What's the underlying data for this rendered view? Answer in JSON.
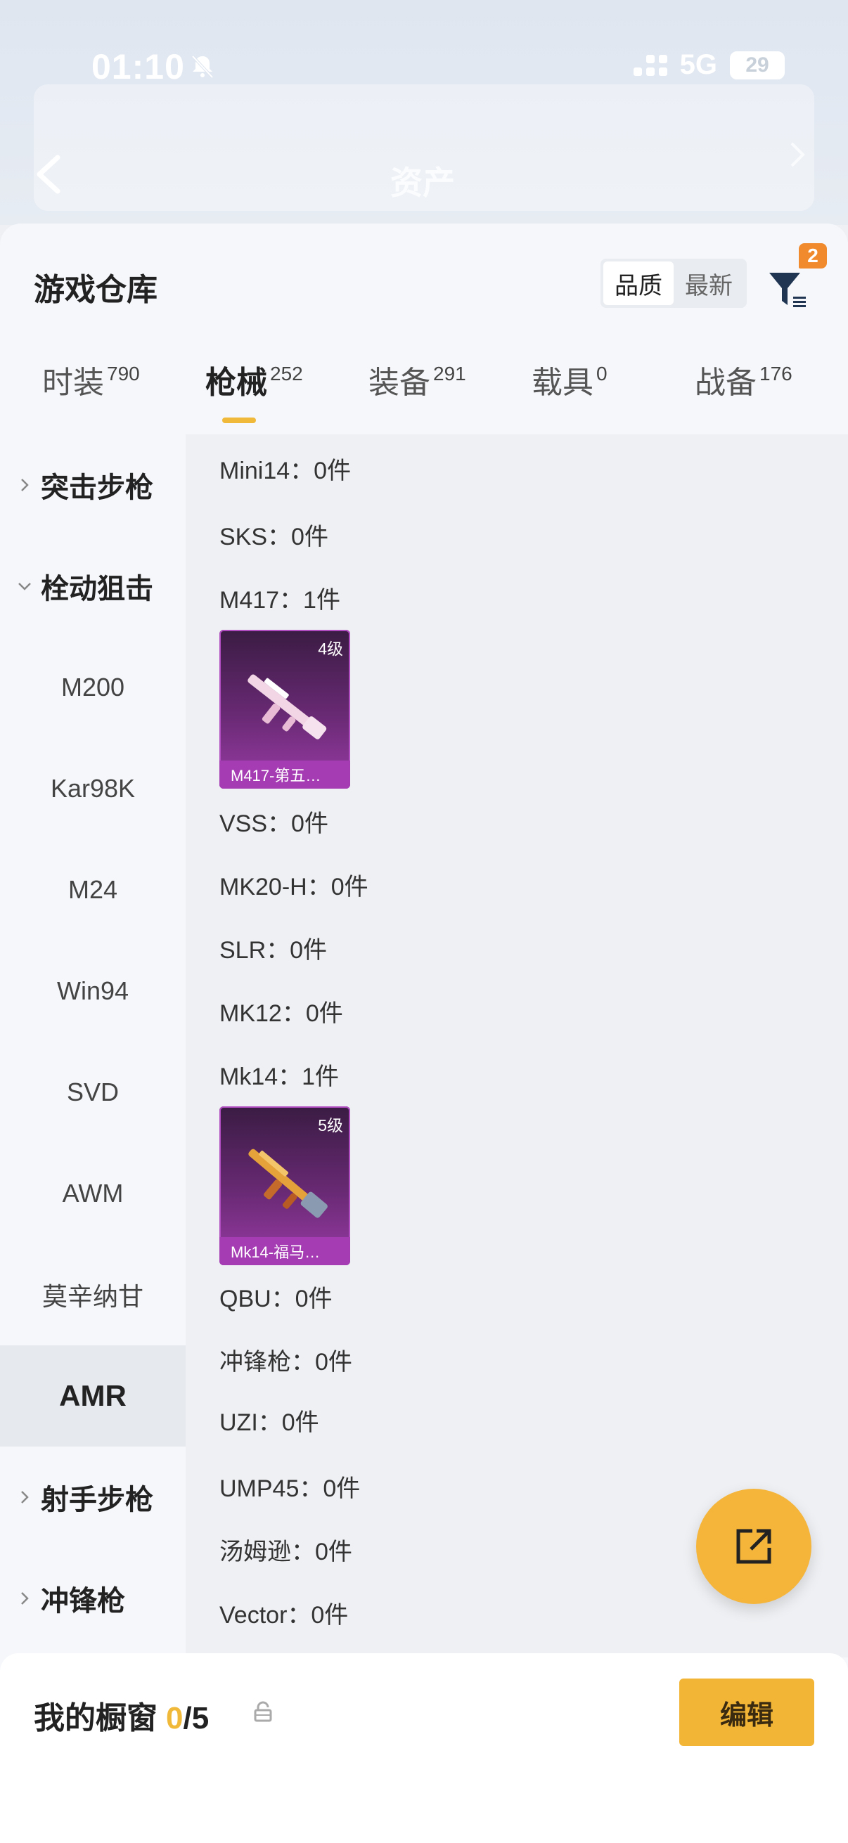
{
  "status_bar": {
    "time": "01:10",
    "network": "5G",
    "battery": "29"
  },
  "background": {
    "title": "资产"
  },
  "sheet": {
    "title": "游戏仓库",
    "sort_options": [
      "品质",
      "最新"
    ],
    "filter_badge": "2"
  },
  "tabs": [
    {
      "label": "时装",
      "count": "790"
    },
    {
      "label": "枪械",
      "count": "252"
    },
    {
      "label": "装备",
      "count": "291"
    },
    {
      "label": "载具",
      "count": "0"
    },
    {
      "label": "战备",
      "count": "176"
    }
  ],
  "sidebar": {
    "groups": {
      "assault": "突击步枪",
      "bolt": "栓动狙击",
      "marksman": "射手步枪",
      "smg": "冲锋枪"
    },
    "bolt_items": [
      "M200",
      "Kar98K",
      "M24",
      "Win94",
      "SVD",
      "AWM",
      "莫辛纳甘",
      "AMR"
    ]
  },
  "content": {
    "rows": {
      "mini14": "Mini14：0件",
      "sks": "SKS：0件",
      "m417": "M417：1件",
      "vss": "VSS：0件",
      "mk20h": "MK20-H：0件",
      "slr": "SLR：0件",
      "mk12": "MK12：0件",
      "mk14": "Mk14：1件",
      "qbu": "QBU：0件",
      "smg_header": "冲锋枪：0件",
      "uzi": "UZI：0件",
      "ump45": "UMP45：0件",
      "thompson": "汤姆逊：0件",
      "vector": "Vector：0件"
    },
    "cards": [
      {
        "level": "4级",
        "name": "M417-第五…"
      },
      {
        "level": "5级",
        "name": "Mk14-福马…"
      }
    ]
  },
  "bottom": {
    "label": "我的橱窗",
    "current": "0",
    "total": "/5",
    "edit_label": "编辑"
  },
  "colors": {
    "accent": "#f0b93a",
    "card_purple": "#a63cb4",
    "badge_orange": "#f08a2c"
  }
}
